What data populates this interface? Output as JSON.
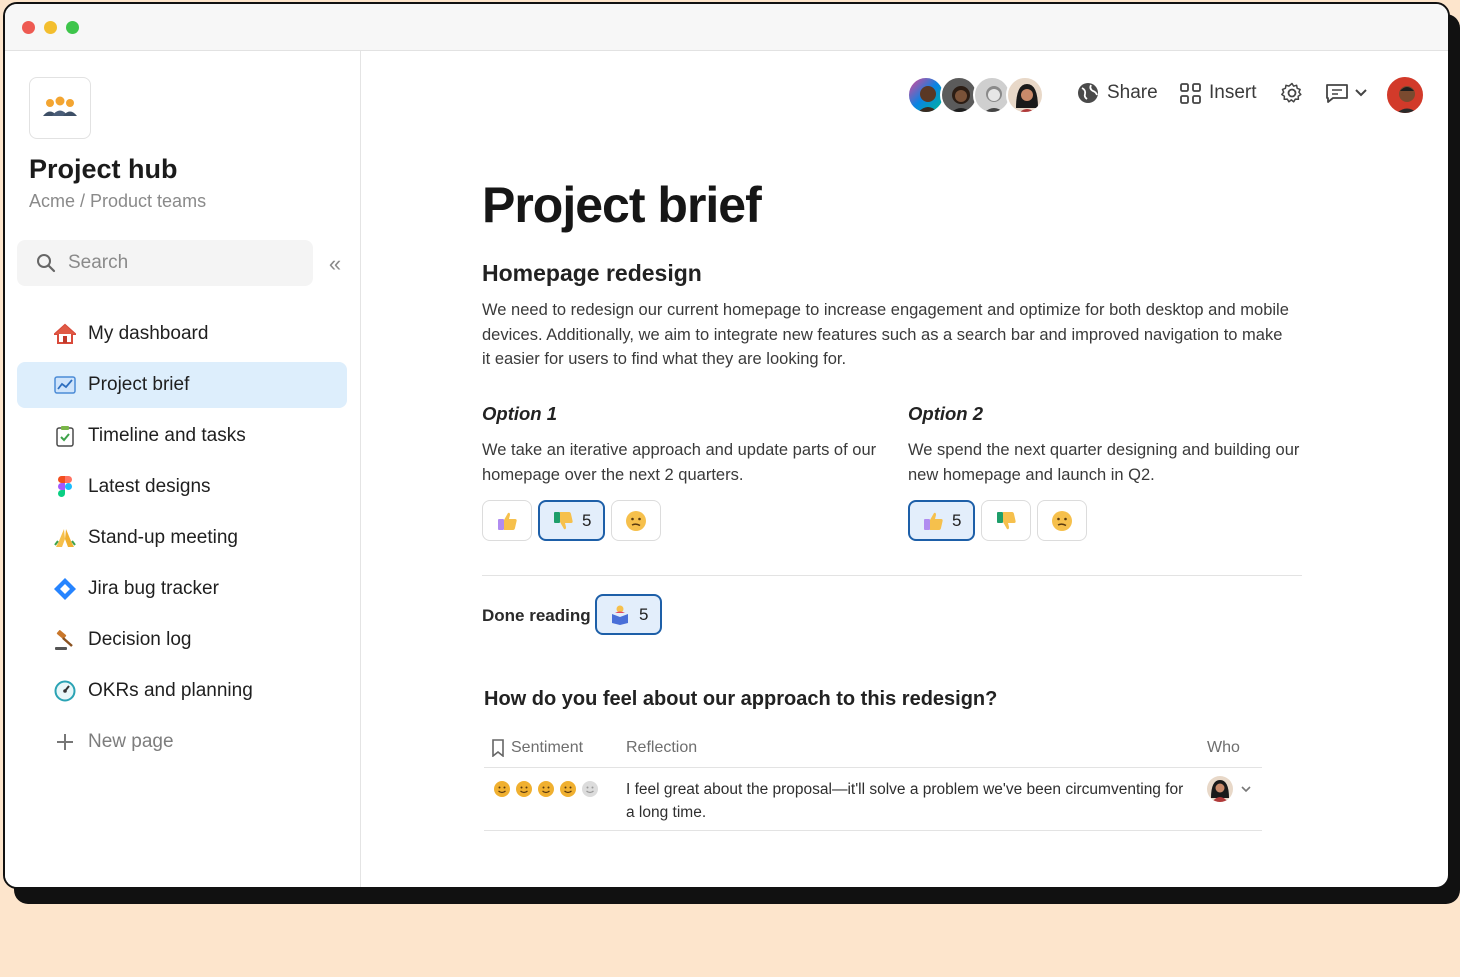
{
  "sidebar": {
    "hub_title": "Project hub",
    "breadcrumb": "Acme / Product teams",
    "search_placeholder": "Search",
    "collapse_glyph": "«",
    "items": [
      {
        "label": "My dashboard",
        "icon": "house-icon"
      },
      {
        "label": "Project brief",
        "icon": "chart-icon",
        "active": true
      },
      {
        "label": "Timeline and tasks",
        "icon": "clipboard-check-icon"
      },
      {
        "label": "Latest designs",
        "icon": "figma-icon"
      },
      {
        "label": "Stand-up meeting",
        "icon": "folded-hands-icon"
      },
      {
        "label": "Jira bug tracker",
        "icon": "jira-icon"
      },
      {
        "label": "Decision log",
        "icon": "gavel-icon"
      },
      {
        "label": "OKRs and planning",
        "icon": "dashboard-gauge-icon"
      },
      {
        "label": "New page",
        "icon": "plus-icon"
      }
    ]
  },
  "toolbar": {
    "share_label": "Share",
    "insert_label": "Insert"
  },
  "doc": {
    "title": "Project brief",
    "heading": "Homepage redesign",
    "paragraph": "We need to redesign our current homepage to increase engagement and optimize for both desktop and mobile devices. Additionally, we aim to integrate new features such as a search bar and improved navigation to make it easier for users to find what they are looking for.",
    "option1": {
      "title": "Option 1",
      "text": "We take an iterative approach and update parts of our homepage over the next 2 quarters.",
      "reactions": [
        {
          "emoji": "thumbs-up",
          "count": "",
          "selected": false
        },
        {
          "emoji": "thumbs-down",
          "count": "5",
          "selected": true
        },
        {
          "emoji": "confused-face",
          "count": "",
          "selected": false
        }
      ]
    },
    "option2": {
      "title": "Option 2",
      "text": "We spend the next quarter designing and building our new homepage and launch in Q2.",
      "reactions": [
        {
          "emoji": "thumbs-up",
          "count": "5",
          "selected": true
        },
        {
          "emoji": "thumbs-down",
          "count": "",
          "selected": false
        },
        {
          "emoji": "confused-face",
          "count": "",
          "selected": false
        }
      ]
    },
    "done_reading": {
      "label": "Done reading",
      "count": "5",
      "emoji": "reading-person"
    },
    "survey": {
      "question": "How do you feel about our approach to this redesign?",
      "columns": [
        "Sentiment",
        "Reflection",
        "Who"
      ],
      "rows": [
        {
          "sentiment_rating": 4,
          "sentiment_max": 5,
          "reflection": "I feel great about the proposal—it'll solve a problem we've been circumventing for a long time."
        }
      ]
    }
  },
  "colors": {
    "accent": "#1d5fa8",
    "active_nav": "#ddeefc",
    "background": "#fde5cc"
  }
}
